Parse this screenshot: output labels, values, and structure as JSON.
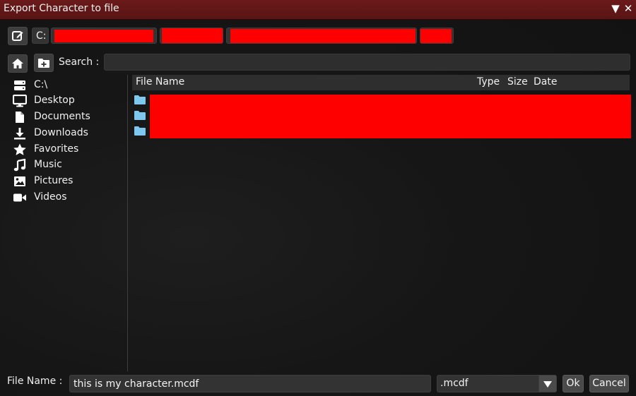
{
  "window": {
    "title": "Export Character to file",
    "collapse_glyph": "▼",
    "close_glyph": "✕"
  },
  "path_bar": {
    "edit_icon": "edit-icon",
    "segments": [
      {
        "label": "C:",
        "redacted": false
      },
      {
        "label": "",
        "redacted": true
      },
      {
        "label": "",
        "redacted": true
      },
      {
        "label": "",
        "redacted": true
      },
      {
        "label": "",
        "redacted": true
      }
    ]
  },
  "search": {
    "label": "Search :",
    "value": "",
    "home_icon": "home-icon",
    "new_folder_icon": "new-folder-icon"
  },
  "sidebar": {
    "items": [
      {
        "label": "C:\\",
        "icon": "drive-icon"
      },
      {
        "label": "Desktop",
        "icon": "desktop-icon"
      },
      {
        "label": "Documents",
        "icon": "document-icon"
      },
      {
        "label": "Downloads",
        "icon": "download-icon"
      },
      {
        "label": "Favorites",
        "icon": "star-icon"
      },
      {
        "label": "Music",
        "icon": "music-icon"
      },
      {
        "label": "Pictures",
        "icon": "picture-icon"
      },
      {
        "label": "Videos",
        "icon": "video-icon"
      }
    ]
  },
  "file_table": {
    "columns": {
      "name": "File Name",
      "type": "Type",
      "size": "Size",
      "date": "Date"
    },
    "rows": [
      {
        "name": "",
        "icon": "folder-icon",
        "redacted": true
      },
      {
        "name": "",
        "icon": "folder-icon",
        "redacted": true
      },
      {
        "name": "",
        "icon": "folder-icon",
        "redacted": true
      }
    ]
  },
  "footer": {
    "file_name_label": "File Name :",
    "file_name_value": "this is my character.mcdf",
    "filter_value": ".mcdf",
    "ok_label": "Ok",
    "cancel_label": "Cancel"
  },
  "colors": {
    "titlebar": "#5a1414",
    "background": "#151515",
    "folder": "#7ec8f0",
    "redaction": "#ff0000"
  }
}
